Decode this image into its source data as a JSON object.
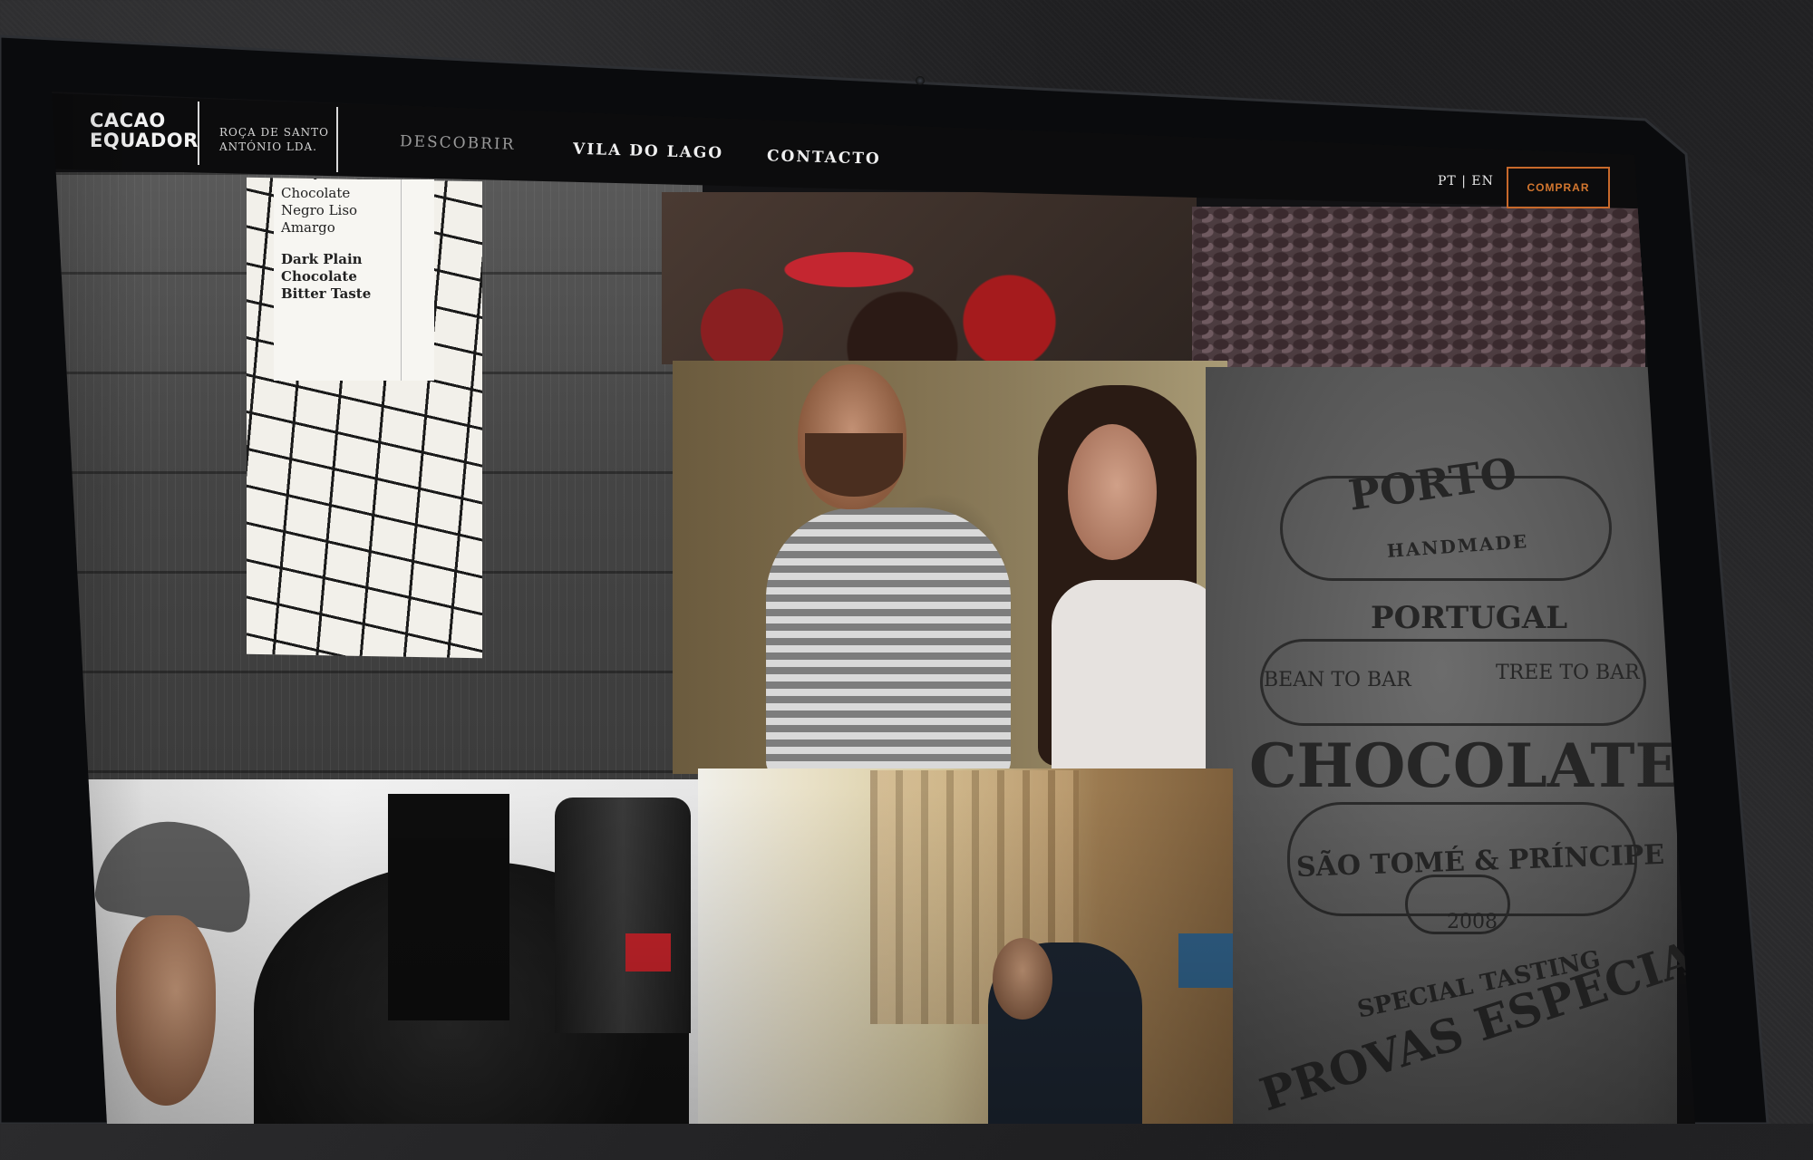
{
  "brand": {
    "logo_line1": "CACAO",
    "logo_line2": "EQUADOR",
    "sub_line1": "ROÇA DE SANTO",
    "sub_line2": "ANTÓNIO LDA."
  },
  "nav": {
    "items": [
      {
        "label": "DESCOBRIR",
        "active": false
      },
      {
        "label": "VILA DO LAGO",
        "active": true
      },
      {
        "label": "CONTACTO",
        "active": true
      }
    ],
    "lang_pt": "PT",
    "lang_sep": "|",
    "lang_en": "EN",
    "cta_label": "COMPRAR"
  },
  "product_label": {
    "pt_line1": "Chocolate",
    "pt_line2": "Negro Liso",
    "pt_line3": "Amargo",
    "en_line1": "Dark Plain",
    "en_line2": "Chocolate",
    "en_line3": "Bitter Taste"
  },
  "stamp": {
    "porto": "PORTO",
    "handmade": "HANDMADE",
    "portugal": "PORTUGAL",
    "bean_to_bar": "BEAN TO BAR",
    "tree_to_bar": "TREE TO BAR",
    "chocolate": "CHOCOLATE",
    "origin": "SÃO TOMÉ & PRÍNCIPE",
    "year": "2008",
    "special": "SPECIAL TASTING",
    "provas": "PROVAS ESPECIAIS"
  },
  "colors": {
    "nav_bg": "#0c0c0d",
    "accent": "#c8692b",
    "text": "#efefef",
    "muted": "#9a9a9a"
  }
}
